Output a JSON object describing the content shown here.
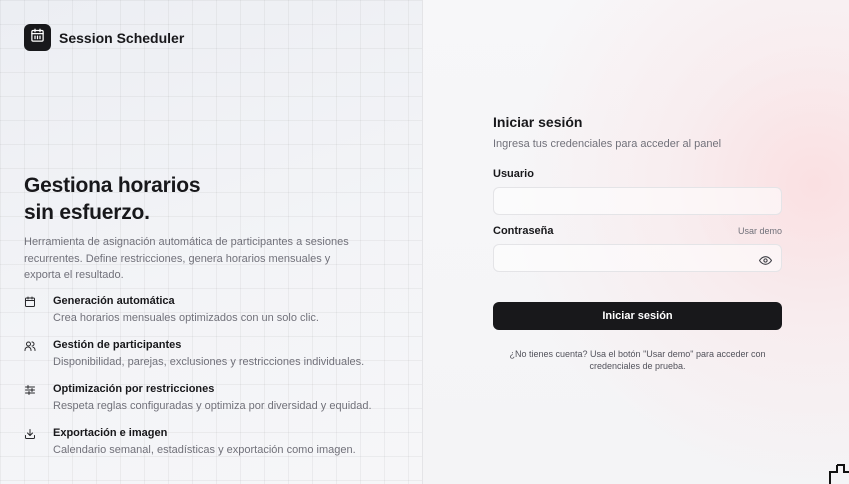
{
  "brand": {
    "name": "Session Scheduler",
    "logo_icon": "calendar-icon"
  },
  "hero": {
    "title_line1": "Gestiona horarios",
    "title_line2": "sin esfuerzo.",
    "description": "Herramienta de asignación automática de participantes a sesiones recurrentes. Define restricciones, genera horarios mensuales y exporta el resultado."
  },
  "features": [
    {
      "icon": "calendar-icon",
      "title": "Generación automática",
      "description": "Crea horarios mensuales optimizados con un solo clic."
    },
    {
      "icon": "users-icon",
      "title": "Gestión de participantes",
      "description": "Disponibilidad, parejas, exclusiones y restricciones individuales."
    },
    {
      "icon": "sliders-icon",
      "title": "Optimización por restricciones",
      "description": "Respeta reglas configuradas y optimiza por diversidad y equidad."
    },
    {
      "icon": "download-icon",
      "title": "Exportación e imagen",
      "description": "Calendario semanal, estadísticas y exportación como imagen."
    }
  ],
  "login": {
    "title": "Iniciar sesión",
    "subtitle": "Ingresa tus credenciales para acceder al panel",
    "username_label": "Usuario",
    "username_value": "",
    "username_placeholder": "",
    "password_label": "Contraseña",
    "password_value": "",
    "password_placeholder": "",
    "demo_link": "Usar demo",
    "submit_label": "Iniciar sesión",
    "hint": "¿No tienes cuenta? Usa el botón \"Usar demo\" para acceder con credenciales de prueba."
  },
  "colors": {
    "primary": "#18181b",
    "muted_text": "#71717a",
    "border": "#e4e4e7",
    "accent_glow": "#fbdcde"
  }
}
